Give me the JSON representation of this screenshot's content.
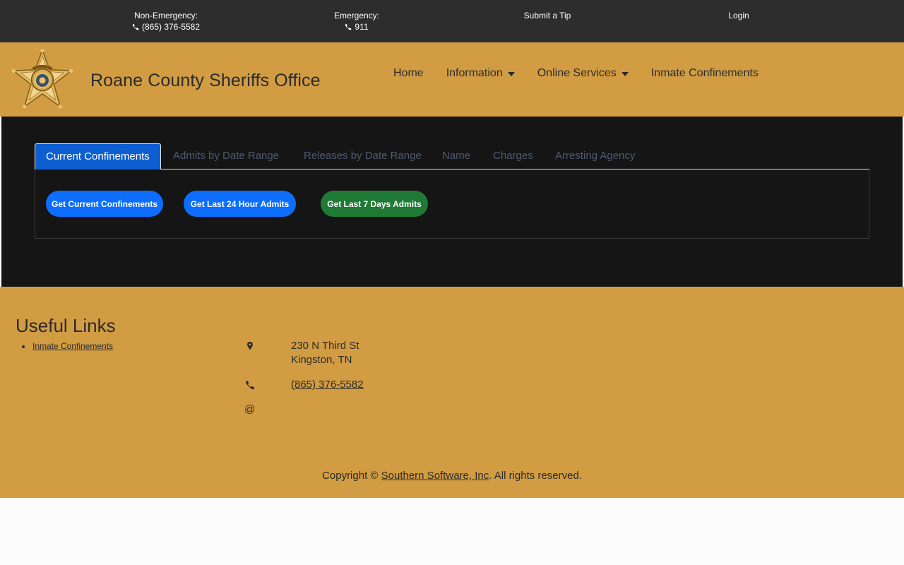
{
  "topbar": {
    "non_emergency_label": "Non-Emergency:",
    "non_emergency_phone": "(865) 376-5582",
    "emergency_label": "Emergency:",
    "emergency_phone": "911",
    "submit_tip": "Submit a Tip",
    "login": "Login"
  },
  "header": {
    "title": "Roane County Sheriffs Office",
    "nav": {
      "home": "Home",
      "information": "Information",
      "online_services": "Online Services",
      "inmate_confinements": "Inmate Confinements"
    }
  },
  "tabs": {
    "current": "Current Confinements",
    "admits": "Admits by Date Range",
    "releases": "Releases by Date Range",
    "name": "Name",
    "charges": "Charges",
    "agency": "Arresting Agency"
  },
  "buttons": {
    "current": "Get Current Confinements",
    "last24": "Get Last 24 Hour Admits",
    "last7": "Get Last 7 Days Admits"
  },
  "footer": {
    "useful_links_title": "Useful Links",
    "link_inmate": "Inmate Confinements",
    "address_line1": "230 N Third St",
    "address_line2": "Kingston, TN",
    "phone": "(865) 376-5582",
    "email_symbol": "@",
    "copyright_prefix": "Copyright ©",
    "copyright_company": "Southern Software, Inc",
    "copyright_suffix": ". All rights reserved."
  },
  "colors": {
    "gold": "#d19c42",
    "dark": "#151515",
    "topbar": "#2d2d2d",
    "active_tab": "#0d5fd1",
    "blue_button": "#0d6efd",
    "green_button": "#1e7a34"
  }
}
